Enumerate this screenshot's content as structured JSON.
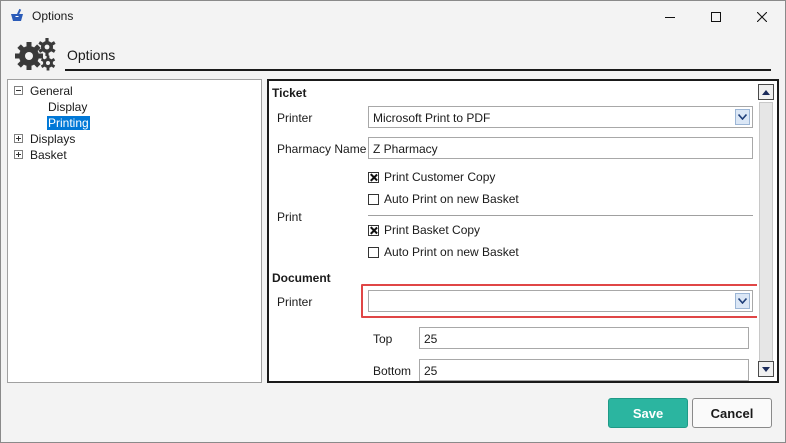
{
  "window": {
    "title": "Options"
  },
  "header": {
    "title": "Options"
  },
  "tree": {
    "items": [
      {
        "label": "General",
        "expanded": true
      },
      {
        "label": "Display"
      },
      {
        "label": "Printing",
        "selected": true
      },
      {
        "label": "Displays",
        "expanded": false
      },
      {
        "label": "Basket",
        "expanded": false
      }
    ]
  },
  "ticket": {
    "heading": "Ticket",
    "printer_label": "Printer",
    "printer_value": "Microsoft Print to PDF",
    "pharmacy_label": "Pharmacy Name",
    "pharmacy_value": "Z Pharmacy",
    "print_label": "Print",
    "print_customer_copy": {
      "label": "Print Customer Copy",
      "checked": true
    },
    "auto_print_1": {
      "label": "Auto Print on new Basket",
      "checked": false
    },
    "print_basket_copy": {
      "label": "Print Basket Copy",
      "checked": true
    },
    "auto_print_2": {
      "label": "Auto Print on new Basket",
      "checked": false
    }
  },
  "document": {
    "heading": "Document",
    "printer_label": "Printer",
    "printer_value": "",
    "top_label": "Top",
    "top_value": "25",
    "bottom_label": "Bottom",
    "bottom_value": "25"
  },
  "buttons": {
    "save": "Save",
    "cancel": "Cancel"
  },
  "colors": {
    "accent": "#2bb5a0",
    "selection": "#0078d7",
    "highlight": "#e04646"
  }
}
